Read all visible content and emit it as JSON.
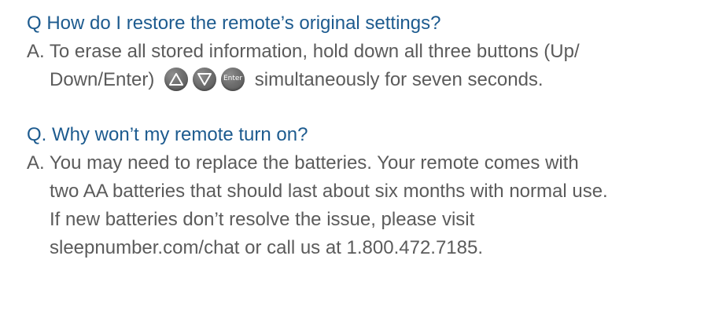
{
  "faq": [
    {
      "question": "Q How do I restore the remote’s original settings?",
      "answer_line1": "A. To erase all stored information, hold down all three buttons (Up/",
      "answer_line2_before": "Down/Enter)",
      "answer_line2_after": "simultaneously for seven seconds.",
      "buttons": [
        {
          "icon": "up-triangle-icon"
        },
        {
          "icon": "down-triangle-icon"
        },
        {
          "icon": "enter-icon",
          "label": "Enter"
        }
      ]
    },
    {
      "question": "Q. Why won’t my remote turn on?",
      "answer_lines": [
        "A. You may need to replace the batteries. Your remote comes with",
        "two AA batteries that should last about six months with normal use.",
        "If new batteries don’t resolve the issue, please visit",
        "sleepnumber.com/chat or call us at 1.800.472.7185."
      ]
    }
  ],
  "colors": {
    "question": "#1d5b8f",
    "answer": "#5b5b5b",
    "button": "#6f6f6f"
  }
}
